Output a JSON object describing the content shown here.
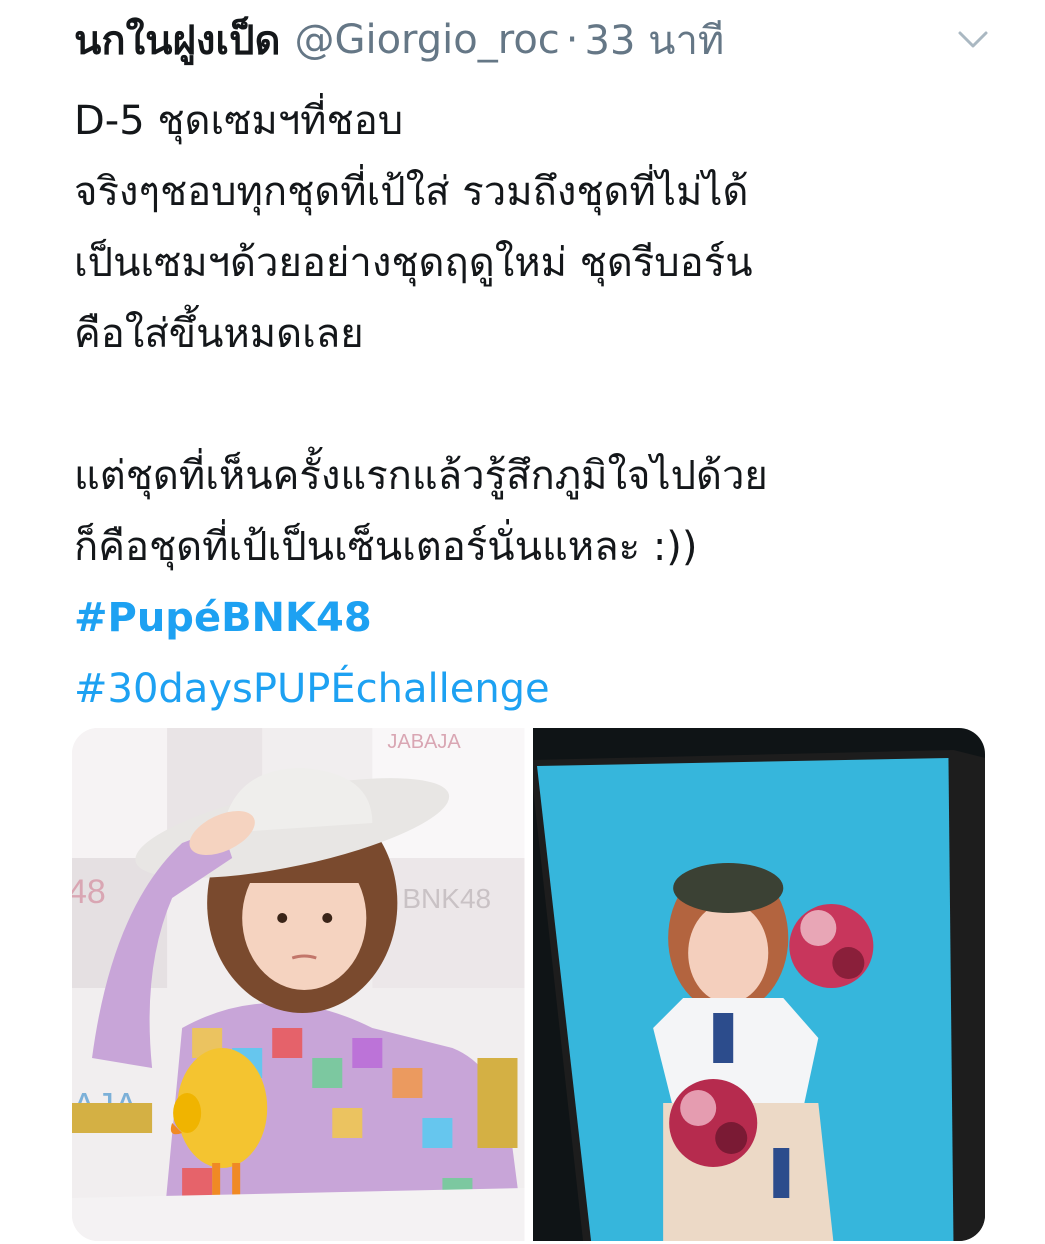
{
  "tweet": {
    "display_name": "นกในฝูงเป็ด",
    "handle": "@Giorgio_roc",
    "separator": "·",
    "time": "33 นาที",
    "lines": [
      "D-5 ชุดเซมฯที่ชอบ",
      "จริงๆชอบทุกชุดที่เป้ใส่ รวมถึงชุดที่ไม่ได้",
      "เป็นเซมฯด้วยอย่างชุดฤดูใหม่ ชุดรีบอร์น",
      "คือใส่ขึ้นหมดเลย",
      "แต่ชุดที่เห็นครั้งแรกแล้วรู้สึกภูมิใจไปด้วย",
      "ก็คือชุดที่เป้เป็นเซ็นเตอร์นั่นแหละ :))"
    ],
    "hashtags": [
      "#PupéBNK48",
      "#30daysPUPÉchallenge"
    ]
  },
  "media": {
    "photo1": {
      "bg_text_1": "JABAJA",
      "bg_text_2": "BNK48",
      "bg_text_3": "48",
      "bg_text_4": "AJA"
    },
    "photo2": {}
  },
  "colors": {
    "text": "#14171a",
    "secondary": "#657786",
    "link": "#1da1f2"
  },
  "icons": {
    "caret": "chevron-down-icon"
  }
}
